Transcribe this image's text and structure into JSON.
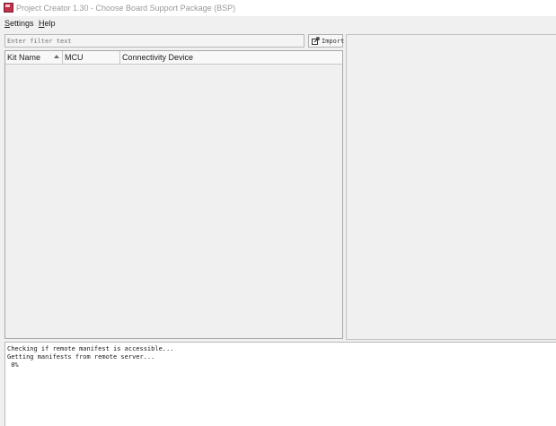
{
  "window": {
    "title": "Project Creator 1.30 - Choose Board Support Package (BSP)",
    "icon": "project-creator-app-icon"
  },
  "menu": {
    "items": [
      {
        "label": "Settings",
        "mnemonic": "S",
        "rest": "ettings"
      },
      {
        "label": "Help",
        "mnemonic": "H",
        "rest": "elp"
      }
    ]
  },
  "filter": {
    "placeholder": "Enter filter text",
    "value": ""
  },
  "import_button": {
    "label": "Import",
    "icon": "import-icon"
  },
  "table": {
    "columns": [
      {
        "label": "Kit Name",
        "sorted": "ascending"
      },
      {
        "label": "MCU"
      },
      {
        "label": "Connectivity Device"
      }
    ],
    "rows": []
  },
  "log": {
    "lines": [
      "Checking if remote manifest is accessible...",
      "Getting manifests from remote server...",
      " 0%"
    ]
  },
  "colors": {
    "window_bg": "#f0f0f0",
    "title_text": "#9a9a9a",
    "app_icon": "#c1314a"
  }
}
